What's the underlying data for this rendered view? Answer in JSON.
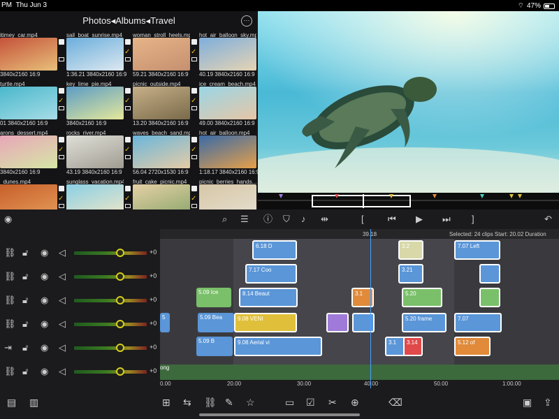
{
  "status": {
    "time": "PM",
    "date": "Thu Jun 3",
    "battery": "47%"
  },
  "browser": {
    "breadcrumb": "Photos◂Albums◂Travel",
    "more": "···",
    "tiles": [
      {
        "name": "itimey_car.mp4",
        "meta": "3840x2160   16:9",
        "c1": "#c5523a",
        "c2": "#e8c07a",
        "checked": false
      },
      {
        "name": "sail_boat_sunrise.mp4",
        "meta": "1:36.21  3840x2160  16:9",
        "c1": "#6aaedc",
        "c2": "#dde8f0",
        "checked": true
      },
      {
        "name": "woman_stroll_heels.mp4",
        "meta": "59.21  3840x2160  16:9",
        "c1": "#e6b488",
        "c2": "#c59070",
        "checked": true
      },
      {
        "name": "hot_air_balloon_sky.mp4",
        "meta": "40.19  3840x2160  16:9",
        "c1": "#7eaedc",
        "c2": "#e6d4b4",
        "checked": true
      },
      {
        "name": "turtle.mp4",
        "meta": "01  3840x2160  16:9",
        "c1": "#4ab8cc",
        "c2": "#a6dce6",
        "checked": true
      },
      {
        "name": "key_lime_pie.mp4",
        "meta": "3840x2160  16:9",
        "c1": "#5a9cc6",
        "c2": "#e6e89a",
        "checked": true
      },
      {
        "name": "picnic_outside.mp4",
        "meta": "13.20  3840x2160  16:9",
        "c1": "#c6b088",
        "c2": "#7a6a4a",
        "checked": true
      },
      {
        "name": "ice_cream_beach.mp4",
        "meta": "49.00  3840x2160  16:9",
        "c1": "#9ad6e6",
        "c2": "#e6c6a6",
        "checked": true
      },
      {
        "name": "arons_dessert.mp4",
        "meta": "3840x2160  16:9",
        "c1": "#e8a6b8",
        "c2": "#d6e6a6",
        "checked": true
      },
      {
        "name": "rocks_river.mp4",
        "meta": "43.19  3840x2160  16:9",
        "c1": "#e0e0d8",
        "c2": "#a09c92",
        "checked": true
      },
      {
        "name": "waves_beach_sand.mp4",
        "meta": "56.04  2720x1530  16:9",
        "c1": "#6ab6dc",
        "c2": "#e6cca6",
        "checked": true
      },
      {
        "name": "hot_air_balloon.mp4",
        "meta": "1:18.17  3840x2160  16:9",
        "c1": "#3a6aa6",
        "c2": "#e6a04a",
        "checked": false
      },
      {
        "name": "_dunes.mp4",
        "meta": "",
        "c1": "#c6602a",
        "c2": "#e69a5a",
        "checked": true
      },
      {
        "name": "sunglass_vacation.mp4",
        "meta": "",
        "c1": "#8ad0e6",
        "c2": "#f0e6c6",
        "checked": true
      },
      {
        "name": "fruit_cake_picnic.mp4",
        "meta": "",
        "c1": "#e6d0a6",
        "c2": "#8aa66a",
        "checked": true
      },
      {
        "name": "picnic_berries_hands....",
        "meta": "",
        "c1": "#d6c6a6",
        "c2": "#e6e0d0",
        "checked": true
      }
    ]
  },
  "timeline": {
    "playhead_time": "39.18",
    "info": "Selected: 24 clips  Start: 20.02  Duration",
    "track_gain": "+0",
    "ruler": [
      "0.00",
      "20.00",
      "30.00",
      "40.00",
      "50.00",
      "1:00.00"
    ],
    "audio_label": "ong",
    "clips": [
      {
        "label": "6.18   D",
        "color": "#5a96d8",
        "selected": true
      },
      {
        "label": "3.2",
        "color": "#d8d8a8",
        "selected": true
      },
      {
        "label": "7.07   Left",
        "color": "#5a96d8",
        "selected": true
      },
      {
        "label": "7.17   Coo",
        "color": "#5a96d8",
        "selected": true
      },
      {
        "label": "3.21",
        "color": "#5a96d8",
        "selected": true
      },
      {
        "label": "",
        "color": "#5a96d8",
        "selected": true
      },
      {
        "label": "5.09   Ice",
        "color": "#7ac06a",
        "selected": false
      },
      {
        "label": "8.14   Beaut",
        "color": "#5a96d8",
        "selected": true
      },
      {
        "label": "3.1",
        "color": "#e08a3a",
        "selected": true
      },
      {
        "label": "5.20",
        "color": "#7ac06a",
        "selected": true
      },
      {
        "label": "",
        "color": "#7ac06a",
        "selected": true
      },
      {
        "label": "5",
        "color": "#5a96d8",
        "selected": false
      },
      {
        "label": "5.09   Bea",
        "color": "#5a96d8",
        "selected": false
      },
      {
        "label": "9.08   VENI",
        "color": "#e0c03a",
        "selected": true
      },
      {
        "label": "",
        "color": "#a07ad8",
        "selected": true
      },
      {
        "label": "",
        "color": "#5a96d8",
        "selected": true
      },
      {
        "label": "5.20   frame",
        "color": "#5a96d8",
        "selected": true
      },
      {
        "label": "7.07",
        "color": "#5a96d8",
        "selected": true
      },
      {
        "label": "5.09   B",
        "color": "#5a96d8",
        "selected": false
      },
      {
        "label": "9.08   Aerial vi",
        "color": "#5a96d8",
        "selected": true
      },
      {
        "label": "3.1",
        "color": "#5a96d8",
        "selected": true
      },
      {
        "label": "3.14",
        "color": "#e04a4a",
        "selected": true
      },
      {
        "label": "5.12   of",
        "color": "#e08a3a",
        "selected": true
      }
    ]
  },
  "icons": {
    "browser_tools": [
      "record-icon",
      "search-icon",
      "list-icon"
    ],
    "viewer_tools": [
      "info-icon",
      "marker-icon",
      "add-audio-icon",
      "split-icon",
      "in-point-icon",
      "prev-frame-icon",
      "play-icon",
      "next-frame-icon",
      "out-point-icon",
      "undo-icon"
    ],
    "track_controls": [
      "link-icon",
      "lock-icon",
      "eye-icon",
      "speaker-icon"
    ],
    "bottom_tools": [
      "inspector-icon",
      "audio-meter-icon",
      "add-clip-icon",
      "replace-icon",
      "link-icon",
      "pen-icon",
      "favorite-icon",
      "clipboard-icon",
      "select-icon",
      "scissors-icon",
      "add-icon",
      "trash-icon",
      "layout-icon",
      "share-icon"
    ]
  }
}
